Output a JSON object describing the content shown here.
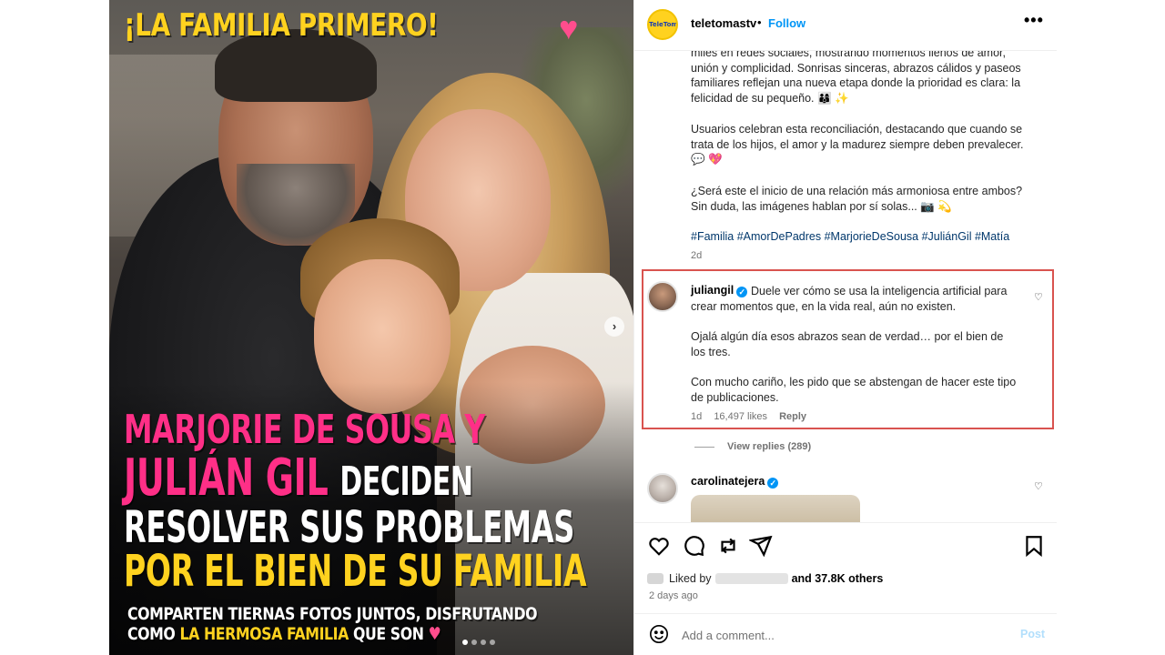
{
  "post_image": {
    "top_title": "¡LA FAMILIA PRIMERO!",
    "top_heart": "♥",
    "line1": "MARJORIE DE SOUSA Y",
    "line2_pink": "JULIÁN GIL",
    "line2_white": "DECIDEN",
    "line3": "RESOLVER SUS PROBLEMAS",
    "line4": "POR EL BIEN DE SU FAMILIA",
    "sub1": "COMPARTEN TIERNAS FOTOS JUNTOS, DISFRUTANDO",
    "sub2_a": "COMO",
    "sub2_yellow": "LA HERMOSA FAMILIA",
    "sub2_b": "QUE SON",
    "sub2_heart": "♥",
    "next_icon": "›",
    "carousel": {
      "count": 4,
      "active_index": 0
    }
  },
  "header": {
    "avatar_text": "TeleTomas",
    "username": "teletomastv",
    "separator": "•",
    "follow_label": "Follow",
    "more_label": "•••"
  },
  "caption": {
    "para_a": "miles en redes sociales, mostrando momentos llenos de amor, unión y complicidad. Sonrisas sinceras, abrazos cálidos y paseos familiares reflejan una nueva etapa donde la prioridad es clara: la felicidad de su pequeño. 👨‍👩‍👦 ✨",
    "para_b": "Usuarios celebran esta reconciliación, destacando que cuando se trata de los hijos, el amor y la madurez siempre deben prevalecer. 💬 💖",
    "para_c": "¿Será este el inicio de una relación más armoniosa entre ambos? Sin duda, las imágenes hablan por sí solas... 📷 💫",
    "hashtags": "#Familia #AmorDePadres #MarjorieDeSousa #JuliánGil #Matía",
    "time": "2d"
  },
  "highlight_comment": {
    "username": "juliangil",
    "verified_icon": "✓",
    "text1": "Duele ver cómo se usa la inteligencia artificial para crear momentos que, en la vida real, aún no existen.",
    "text2": "Ojalá algún día esos abrazos sean de verdad… por el bien de los tres.",
    "text3": "Con mucho cariño, les pido que se abstengan de hacer este tipo de publicaciones.",
    "time": "1d",
    "likes": "16,497 likes",
    "reply_label": "Reply",
    "view_replies": "View replies (289)",
    "heart_icon": "♡",
    "box_color": "#d9534f"
  },
  "second_comment": {
    "username": "carolinatejera",
    "verified_icon": "✓",
    "heart_icon": "♡"
  },
  "actions": {
    "icons": [
      "heart-icon",
      "comment-icon",
      "repost-icon",
      "share-icon",
      "bookmark-icon"
    ],
    "liked_by_prefix": "Liked by",
    "and_others": "and 37.8K others",
    "time_ago": "2 days ago"
  },
  "add_comment": {
    "placeholder": "Add a comment...",
    "post_label": "Post"
  },
  "colors": {
    "accent_blue": "#0095f6",
    "title_yellow": "#ffd21f",
    "title_pink": "#ff2f87"
  }
}
